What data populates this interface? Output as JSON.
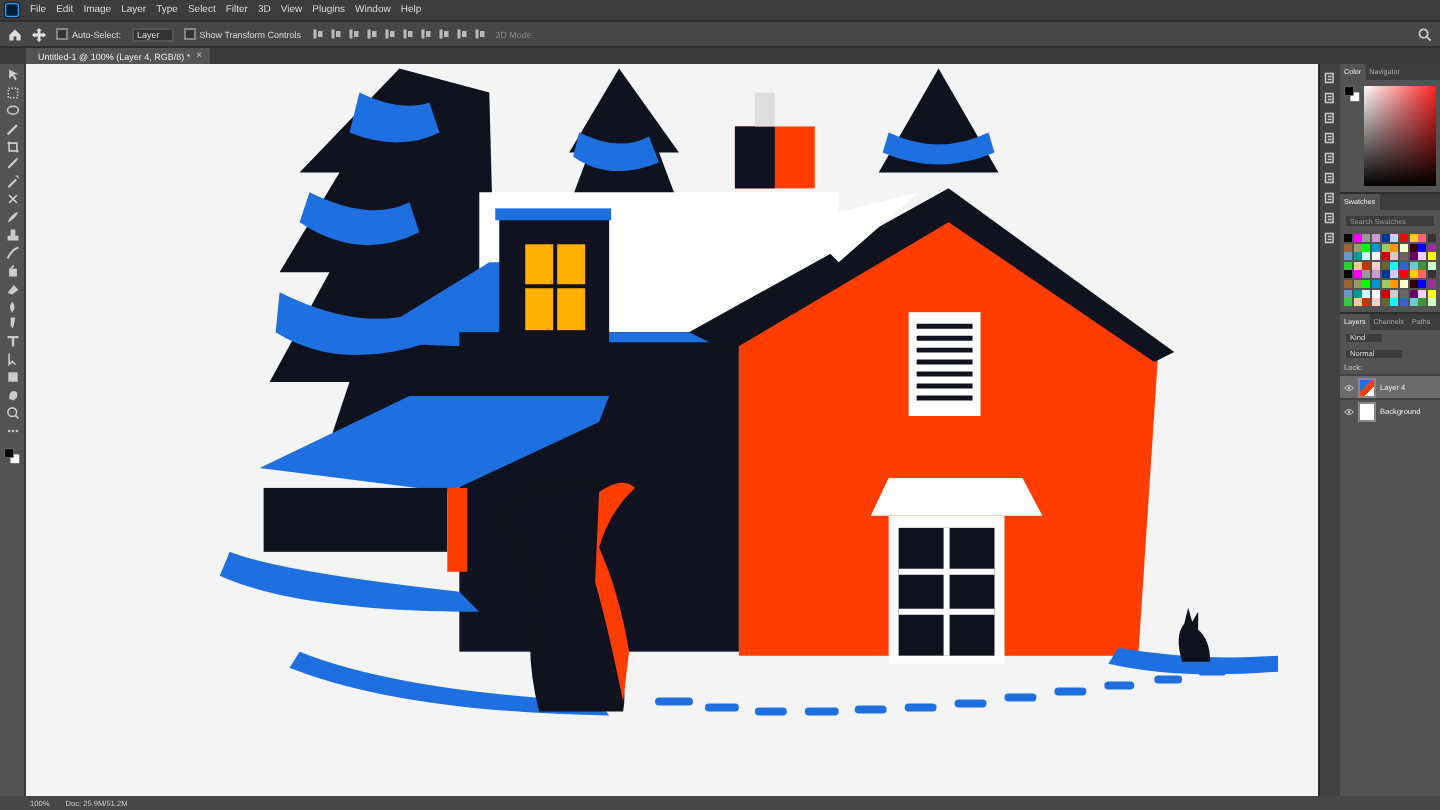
{
  "menu_bar": {
    "items": [
      "File",
      "Edit",
      "Image",
      "Layer",
      "Type",
      "Select",
      "Filter",
      "3D",
      "View",
      "Plugins",
      "Window",
      "Help"
    ]
  },
  "options_bar": {
    "auto_select": {
      "label": "Auto-Select:",
      "checked": false
    },
    "target": "Layer",
    "show_transform": {
      "label": "Show Transform Controls",
      "checked": false
    },
    "mode_label": "3D Mode:"
  },
  "document_tab": {
    "title": "Untitled-1 @ 100% (Layer 4, RGB/8) *",
    "close": "×"
  },
  "color_panel": {
    "tabs": [
      {
        "label": "Color",
        "selected": true
      },
      {
        "label": "Navigator",
        "selected": false
      }
    ]
  },
  "swatches_panel": {
    "tabs": [
      {
        "label": "Swatches",
        "selected": true
      }
    ],
    "search": {
      "placeholder": "Search Swatches"
    }
  },
  "layers_panel": {
    "tabs": [
      {
        "label": "Layers",
        "selected": true
      },
      {
        "label": "Channels",
        "selected": false
      },
      {
        "label": "Paths",
        "selected": false
      }
    ],
    "filter": "Kind",
    "blend_mode": "Normal",
    "lock_label": "Lock:",
    "layers": [
      {
        "name": "Layer 4",
        "visible": true,
        "selected": true
      },
      {
        "name": "Background",
        "visible": true,
        "selected": false
      }
    ]
  },
  "status_bar": {
    "zoom": "100%",
    "doc_info": "Doc: 25.9M/51.2M"
  }
}
